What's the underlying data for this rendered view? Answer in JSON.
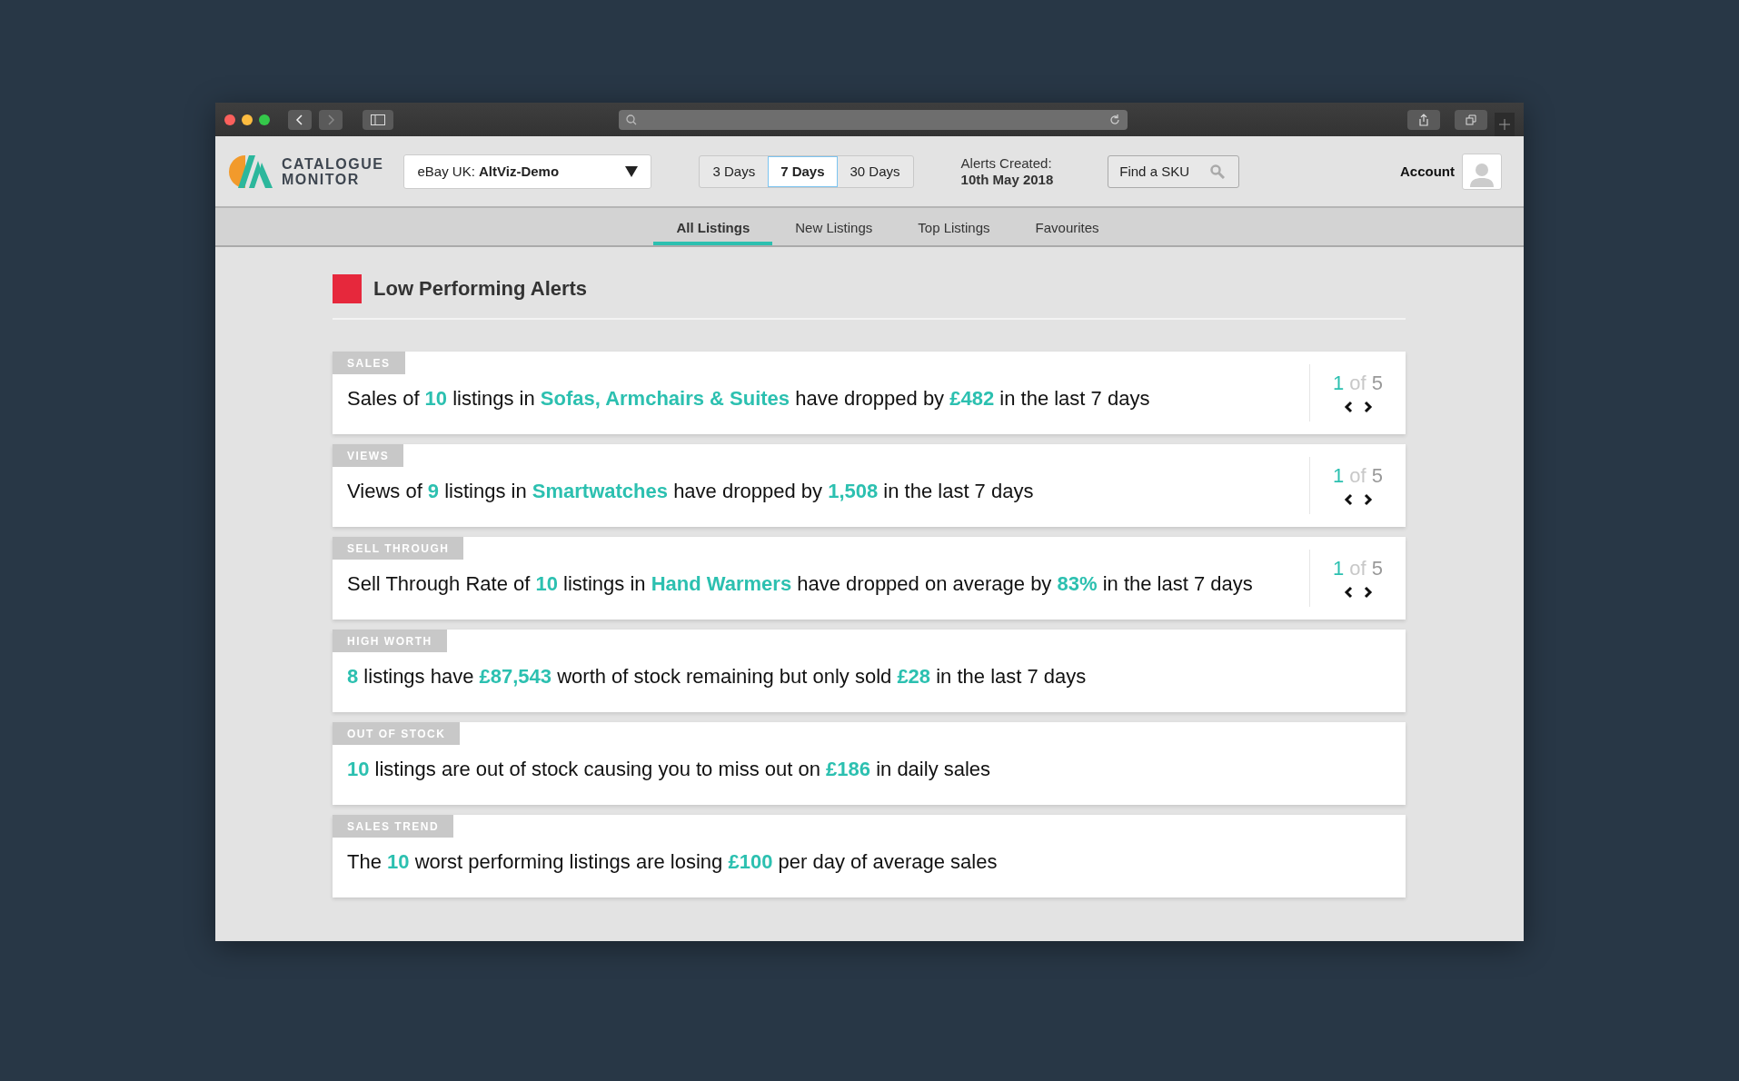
{
  "logo": {
    "line1": "CATALOGUE",
    "line2": "MONITOR"
  },
  "account_select": {
    "value": "eBay UK: **AltViz-Demo**"
  },
  "period_options": [
    {
      "label": "3 Days",
      "selected": false
    },
    {
      "label": "7 Days",
      "selected": true
    },
    {
      "label": "30 Days",
      "selected": false
    }
  ],
  "alerts_created": {
    "label": "Alerts Created:",
    "date": "10th May 2018"
  },
  "sku_search": {
    "placeholder": "Find a SKU"
  },
  "account": {
    "label": "Account"
  },
  "nav_tabs": [
    {
      "label": "All Listings",
      "selected": true
    },
    {
      "label": "New Listings",
      "selected": false
    },
    {
      "label": "Top Listings",
      "selected": false
    },
    {
      "label": "Favourites",
      "selected": false
    }
  ],
  "section": {
    "title": "Low Performing Alerts"
  },
  "alerts": [
    {
      "category": "SALES",
      "message": "Sales of **10** listings in **Sofas, Armchairs & Suites** have dropped by **£482** in the last 7 days",
      "pager": {
        "current": "1",
        "of": "of",
        "total": "5"
      }
    },
    {
      "category": "VIEWS",
      "message": "Views of **9** listings in **Smartwatches** have dropped by **1,508** in the last 7 days",
      "pager": {
        "current": "1",
        "of": "of",
        "total": "5"
      }
    },
    {
      "category": "SELL THROUGH",
      "message": "Sell Through Rate of **10** listings in **Hand Warmers** have dropped on average by **83%** in the last 7 days",
      "pager": {
        "current": "1",
        "of": "of",
        "total": "5"
      }
    },
    {
      "category": "HIGH WORTH",
      "message": "**8** listings have **£87,543** worth of stock remaining but only sold **£28** in the last 7 days"
    },
    {
      "category": "OUT OF STOCK",
      "message": "**10** listings are out of stock causing you to miss out on **£186** in daily sales"
    },
    {
      "category": "SALES TREND",
      "message": "The **10** worst performing listings are losing **£100** per day of average sales"
    }
  ]
}
